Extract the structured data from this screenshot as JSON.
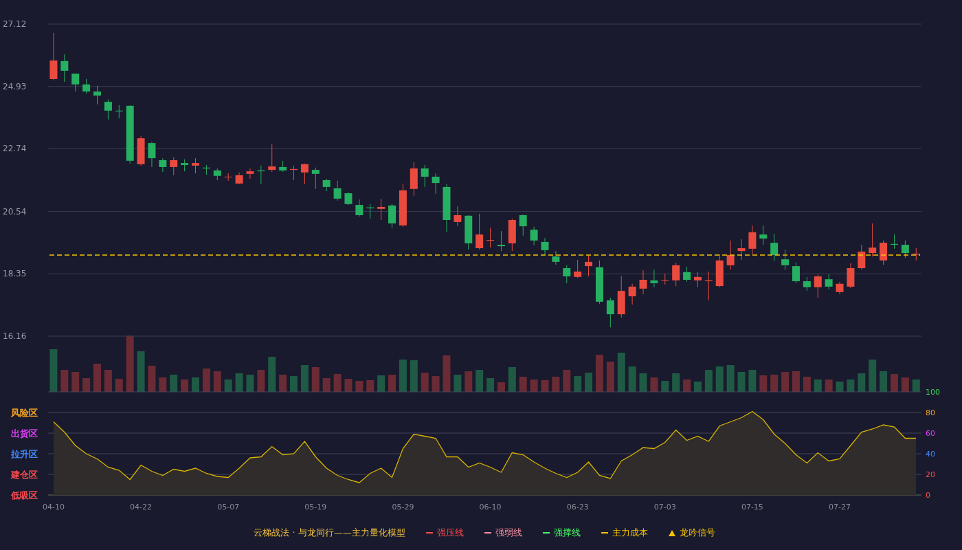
{
  "price_panel": {
    "chart_data": {
      "type": "candlestick",
      "ylim": [
        16.16,
        27.12
      ],
      "yticks": [
        27.12,
        24.93,
        22.74,
        20.54,
        18.35,
        16.16
      ],
      "grid": true,
      "ohlc": [
        [
          25.19,
          26.81,
          25.14,
          25.84
        ],
        [
          25.82,
          26.06,
          25.09,
          25.48
        ],
        [
          25.38,
          25.38,
          24.75,
          25.0
        ],
        [
          25.0,
          25.19,
          24.68,
          24.75
        ],
        [
          24.75,
          24.95,
          24.3,
          24.61
        ],
        [
          24.39,
          24.47,
          23.77,
          24.08
        ],
        [
          24.08,
          24.27,
          23.81,
          24.05
        ],
        [
          24.25,
          24.27,
          22.22,
          22.32
        ],
        [
          22.2,
          23.19,
          22.15,
          23.11
        ],
        [
          22.94,
          22.99,
          22.1,
          22.41
        ],
        [
          22.34,
          22.41,
          21.93,
          22.1
        ],
        [
          22.1,
          22.44,
          21.81,
          22.34
        ],
        [
          22.24,
          22.37,
          21.95,
          22.17
        ],
        [
          22.15,
          22.41,
          21.88,
          22.24
        ],
        [
          22.08,
          22.17,
          21.83,
          22.05
        ],
        [
          21.98,
          22.05,
          21.64,
          21.79
        ],
        [
          21.74,
          21.88,
          21.62,
          21.76
        ],
        [
          21.52,
          21.91,
          21.5,
          21.81
        ],
        [
          21.86,
          22.05,
          21.69,
          21.95
        ],
        [
          21.98,
          22.15,
          21.5,
          21.95
        ],
        [
          22.0,
          22.9,
          21.93,
          22.12
        ],
        [
          22.1,
          22.32,
          21.93,
          21.98
        ],
        [
          22.0,
          22.15,
          21.64,
          22.03
        ],
        [
          21.91,
          22.22,
          21.5,
          22.2
        ],
        [
          22.0,
          22.08,
          21.33,
          21.86
        ],
        [
          21.64,
          21.69,
          21.25,
          21.4
        ],
        [
          21.35,
          21.62,
          20.92,
          20.99
        ],
        [
          21.18,
          21.21,
          20.77,
          20.8
        ],
        [
          20.77,
          20.96,
          20.36,
          20.41
        ],
        [
          20.68,
          20.8,
          20.29,
          20.65
        ],
        [
          20.63,
          20.99,
          20.24,
          20.7
        ],
        [
          20.75,
          20.8,
          19.95,
          20.12
        ],
        [
          20.05,
          21.52,
          20.0,
          21.28
        ],
        [
          21.33,
          22.27,
          21.09,
          22.05
        ],
        [
          22.05,
          22.17,
          21.4,
          21.76
        ],
        [
          21.76,
          21.88,
          21.16,
          21.54
        ],
        [
          21.4,
          21.5,
          19.81,
          20.24
        ],
        [
          20.17,
          20.72,
          20.02,
          20.41
        ],
        [
          20.39,
          20.41,
          19.2,
          19.42
        ],
        [
          19.25,
          20.46,
          19.2,
          19.73
        ],
        [
          19.52,
          19.97,
          19.27,
          19.54
        ],
        [
          19.37,
          19.85,
          19.15,
          19.32
        ],
        [
          19.42,
          20.29,
          19.15,
          20.24
        ],
        [
          20.41,
          20.43,
          19.69,
          20.02
        ],
        [
          19.9,
          20.0,
          19.35,
          19.52
        ],
        [
          19.47,
          19.61,
          19.03,
          19.18
        ],
        [
          18.96,
          19.15,
          18.67,
          18.77
        ],
        [
          18.55,
          18.65,
          18.02,
          18.26
        ],
        [
          18.24,
          18.84,
          18.21,
          18.43
        ],
        [
          18.62,
          18.99,
          18.26,
          18.77
        ],
        [
          18.58,
          18.82,
          17.3,
          17.37
        ],
        [
          17.42,
          17.51,
          16.47,
          16.93
        ],
        [
          16.93,
          18.26,
          16.81,
          17.75
        ],
        [
          17.56,
          18.0,
          17.27,
          17.9
        ],
        [
          17.83,
          18.48,
          17.63,
          18.14
        ],
        [
          18.12,
          18.5,
          17.88,
          18.02
        ],
        [
          18.12,
          18.36,
          17.97,
          18.14
        ],
        [
          18.12,
          18.74,
          17.92,
          18.65
        ],
        [
          18.41,
          18.6,
          18.07,
          18.14
        ],
        [
          18.12,
          18.41,
          17.88,
          18.24
        ],
        [
          18.09,
          18.43,
          17.42,
          18.12
        ],
        [
          17.92,
          19.03,
          17.88,
          18.82
        ],
        [
          18.65,
          19.52,
          18.5,
          19.01
        ],
        [
          19.15,
          19.56,
          18.84,
          19.25
        ],
        [
          19.23,
          20.05,
          19.03,
          19.81
        ],
        [
          19.73,
          20.05,
          19.37,
          19.59
        ],
        [
          19.44,
          19.76,
          18.79,
          19.01
        ],
        [
          18.86,
          19.2,
          18.48,
          18.65
        ],
        [
          18.62,
          18.74,
          18.02,
          18.09
        ],
        [
          18.09,
          18.24,
          17.75,
          17.88
        ],
        [
          17.88,
          18.33,
          17.51,
          18.26
        ],
        [
          18.16,
          18.33,
          17.8,
          17.9
        ],
        [
          17.71,
          18.07,
          17.63,
          18.0
        ],
        [
          17.9,
          18.72,
          17.85,
          18.55
        ],
        [
          18.55,
          19.37,
          18.5,
          19.13
        ],
        [
          19.08,
          20.12,
          18.96,
          19.27
        ],
        [
          18.82,
          19.52,
          18.67,
          19.44
        ],
        [
          19.4,
          19.73,
          19.23,
          19.37
        ],
        [
          19.37,
          19.52,
          18.91,
          19.08
        ],
        [
          19.03,
          19.25,
          18.82,
          19.06
        ]
      ]
    }
  },
  "oscillator_panel": {
    "zones": [
      {
        "color": "#3ddc5a"
      },
      {
        "label": "风险区",
        "color": "#f5a623"
      },
      {
        "label": "出货区",
        "color": "#e040fb"
      },
      {
        "label": "拉升区",
        "color": "#448aff"
      },
      {
        "label": "建仓区",
        "color": "#ff4d4f"
      },
      {
        "label": "低吸区",
        "color": "#ff4d4f"
      }
    ],
    "chart_data": {
      "type": "area",
      "grid": true,
      "categories": [
        "04-10",
        null,
        null,
        null,
        null,
        null,
        null,
        null,
        "04-22",
        null,
        null,
        null,
        null,
        null,
        null,
        null,
        "05-07",
        null,
        null,
        null,
        null,
        null,
        null,
        null,
        "05-19",
        null,
        null,
        null,
        null,
        null,
        null,
        null,
        "05-29",
        null,
        null,
        null,
        null,
        null,
        null,
        null,
        "06-10",
        null,
        null,
        null,
        null,
        null,
        null,
        null,
        "06-23",
        null,
        null,
        null,
        null,
        null,
        null,
        null,
        "07-03",
        null,
        null,
        null,
        null,
        null,
        null,
        null,
        "07-15",
        null,
        null,
        null,
        null,
        null,
        null,
        null,
        "07-27",
        null,
        null,
        null,
        null,
        null,
        null,
        null
      ],
      "values": [
        71,
        61,
        48,
        40,
        35,
        27,
        24,
        15,
        29,
        23,
        19,
        25,
        23,
        26,
        21,
        18,
        17,
        26,
        36,
        37,
        47,
        39,
        40,
        52,
        37,
        26,
        19,
        15,
        12,
        21,
        26,
        17,
        45,
        59,
        57,
        55,
        37,
        37,
        27,
        31,
        27,
        22,
        41,
        39,
        32,
        26,
        21,
        17,
        22,
        32,
        19,
        16,
        33,
        39,
        46,
        45,
        51,
        63,
        53,
        57,
        52,
        67,
        71,
        75,
        81,
        73,
        59,
        50,
        39,
        31,
        41,
        33,
        35,
        48,
        61,
        64,
        68,
        66,
        55,
        55
      ],
      "ylim": [
        0,
        100
      ],
      "yticks": [
        100,
        80,
        60,
        40,
        20,
        0
      ]
    }
  },
  "legend": {
    "title": "云梯战法 · 与龙同行——主力量化模型",
    "items": [
      {
        "label": "强压线",
        "kind": "solid",
        "color": "#ff4d4f"
      },
      {
        "label": "强弱线",
        "kind": "dashed",
        "color": "#ff8fa3"
      },
      {
        "label": "强撑线",
        "kind": "solid",
        "color": "#4cff6a"
      },
      {
        "label": "主力成本",
        "kind": "dashed",
        "color": "#f5c400"
      },
      {
        "label": "龙吟信号",
        "kind": "triangle",
        "color": "#f5c400"
      }
    ]
  }
}
